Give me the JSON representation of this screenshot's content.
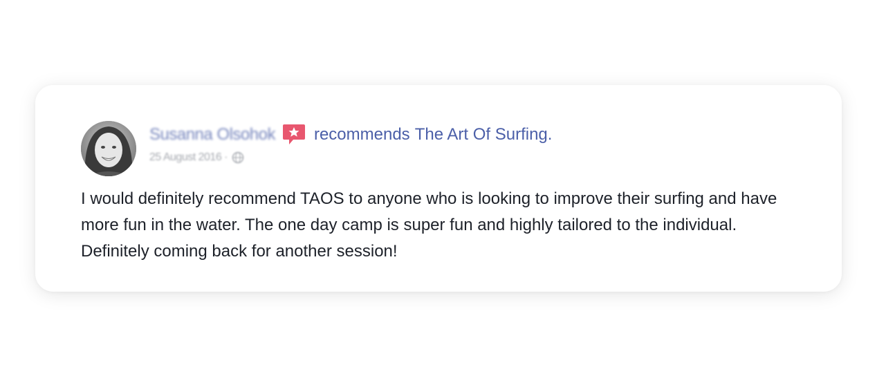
{
  "review": {
    "author": "Susanna Olsohok",
    "verb": "recommends",
    "page_name": "The Art Of Surfing.",
    "date": "25 August 2016 ·",
    "text": "I would definitely recommend TAOS to anyone who is looking to improve their surfing and have more fun in the water. The one day camp is super fun and highly tailored to the individual. Definitely coming back for another session!"
  },
  "colors": {
    "link": "#4b5fa8",
    "text": "#1d2129",
    "meta": "#90949c",
    "badge": "#e8576f"
  },
  "icons": {
    "badge": "recommendation-star-icon",
    "audience": "globe-icon"
  }
}
